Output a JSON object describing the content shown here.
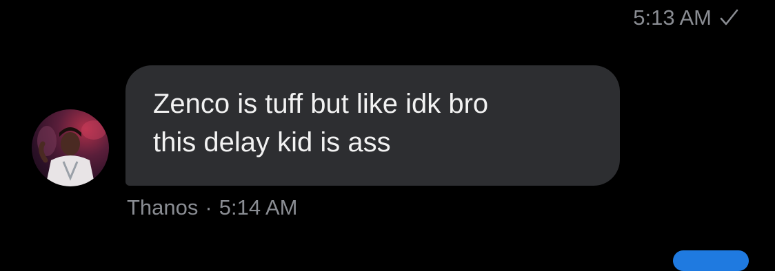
{
  "sent_message": {
    "time": "5:13 AM",
    "status_icon": "checkmark-icon"
  },
  "received_message": {
    "lines": [
      "Zenco is tuff but like idk bro",
      "this delay kid is ass"
    ],
    "sender": "Thanos",
    "separator": "·",
    "time": "5:14 AM",
    "avatar": "user-avatar-photo"
  },
  "colors": {
    "background": "#000000",
    "bubble": "#2d2e31",
    "bubble_text": "#f2f2f2",
    "meta_text": "#8a8d93",
    "accent": "#1f7ae0"
  }
}
